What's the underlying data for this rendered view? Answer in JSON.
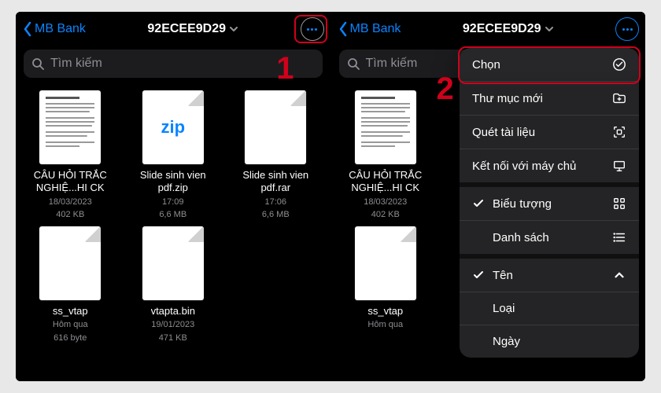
{
  "colors": {
    "accent": "#0a84ff",
    "highlight": "#d0011b"
  },
  "left": {
    "back_label": "MB Bank",
    "title": "92ECEE9D29",
    "search_placeholder": "Tìm kiếm",
    "annotation": "1",
    "files": [
      {
        "name": "CÂU HỎI TRẮC NGHIỆ...HI CK",
        "date": "18/03/2023",
        "size": "402 KB",
        "kind": "doc"
      },
      {
        "name": "Slide sinh vien pdf.zip",
        "date": "17:09",
        "size": "6,6 MB",
        "kind": "zip"
      },
      {
        "name": "Slide sinh vien pdf.rar",
        "date": "17:06",
        "size": "6,6 MB",
        "kind": "blank"
      },
      {
        "name": "ss_vtap",
        "date": "Hôm qua",
        "size": "616 byte",
        "kind": "blank"
      },
      {
        "name": "vtapta.bin",
        "date": "19/01/2023",
        "size": "471 KB",
        "kind": "blank"
      }
    ]
  },
  "right": {
    "back_label": "MB Bank",
    "title": "92ECEE9D29",
    "search_placeholder": "Tìm kiếm",
    "annotation": "2",
    "files": [
      {
        "name": "CÂU HỎI TRẮC NGHIỆ...HI CK",
        "date": "18/03/2023",
        "size": "402 KB",
        "kind": "doc"
      },
      {
        "name": "ss_vtap",
        "date": "Hôm qua",
        "size": "",
        "kind": "blank"
      }
    ],
    "menu": {
      "select": "Chọn",
      "new_folder": "Thư mục mới",
      "scan": "Quét tài liệu",
      "connect": "Kết nối với máy chủ",
      "icons_view": "Biểu tượng",
      "list_view": "Danh sách",
      "sort_name": "Tên",
      "sort_kind": "Loại",
      "sort_date": "Ngày"
    }
  }
}
